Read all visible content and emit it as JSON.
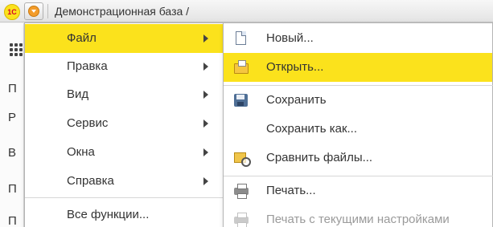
{
  "titlebar": {
    "logo_text": "1C",
    "title": "Демонстрационная база /"
  },
  "background": {
    "strip_letters": [
      "П",
      "Р",
      "В",
      "П",
      "П"
    ]
  },
  "main_menu": {
    "items": [
      {
        "label": "Файл",
        "has_submenu": true,
        "active": true
      },
      {
        "label": "Правка",
        "has_submenu": true
      },
      {
        "label": "Вид",
        "has_submenu": true
      },
      {
        "label": "Сервис",
        "has_submenu": true
      },
      {
        "label": "Окна",
        "has_submenu": true
      },
      {
        "label": "Справка",
        "has_submenu": true
      },
      {
        "label": "Все функции..."
      }
    ]
  },
  "file_menu": {
    "items": [
      {
        "label": "Новый...",
        "icon": "new-document-icon"
      },
      {
        "label": "Открыть...",
        "icon": "open-folder-icon",
        "active": true
      },
      {
        "label": "Сохранить",
        "icon": "save-floppy-icon"
      },
      {
        "label": "Сохранить как..."
      },
      {
        "label": "Сравнить файлы...",
        "icon": "compare-files-icon"
      },
      {
        "label": "Печать...",
        "icon": "printer-icon"
      },
      {
        "label": "Печать с текущими настройками",
        "icon": "printer-icon",
        "disabled": true
      }
    ]
  },
  "colors": {
    "highlight": "#fbe21c",
    "disabled_text": "#9a9a9a"
  }
}
